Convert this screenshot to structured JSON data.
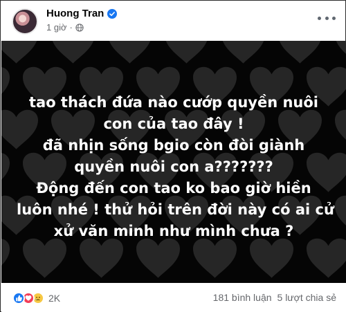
{
  "post": {
    "author": "Huong Tran",
    "time": "1 giờ",
    "separator": "·",
    "privacy_icon": "globe-icon",
    "verified_icon": "verified-badge-icon",
    "more_icon": "more-options-icon",
    "background": "black-hearts",
    "text_lines": [
      "tao thách đứa nào cướp quyền nuôi",
      "con của tao đây !",
      "đã nhịn sống bgio còn đòi giành",
      "quyền nuôi con a???????",
      "Động đến con tao ko bao giờ hiền",
      "luôn nhé ! thử hỏi trên đời này có ai cử",
      "xử văn minh như mình chưa ?"
    ]
  },
  "footer": {
    "reaction_icons": [
      "like-icon",
      "love-icon",
      "sad-icon"
    ],
    "reaction_count": "2K",
    "comments": "181 bình luận",
    "shares": "5 lượt chia sẻ"
  },
  "colors": {
    "post_background": "#050505",
    "heart": "#262626",
    "verified": "#1877f2",
    "secondary_text": "#65676b"
  }
}
